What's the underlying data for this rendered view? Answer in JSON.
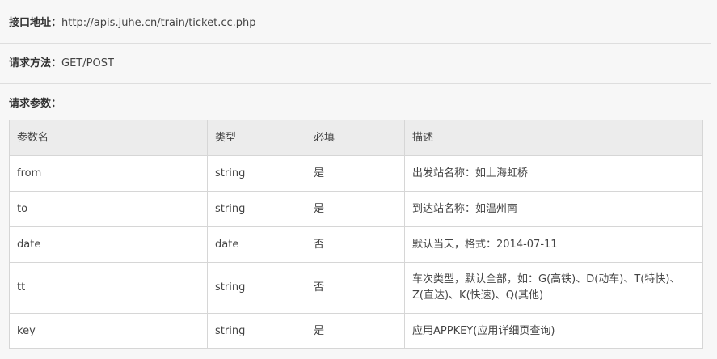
{
  "api": {
    "url_label": "接口地址：",
    "url_value": "http://apis.juhe.cn/train/ticket.cc.php",
    "method_label": "请求方法：",
    "method_value": "GET/POST",
    "params_label": "请求参数："
  },
  "table": {
    "headers": [
      "参数名",
      "类型",
      "必填",
      "描述"
    ],
    "rows": [
      {
        "name": "from",
        "type": "string",
        "required": "是",
        "desc": "出发站名称：如上海虹桥"
      },
      {
        "name": "to",
        "type": "string",
        "required": "是",
        "desc": "到达站名称：如温州南"
      },
      {
        "name": "date",
        "type": "date",
        "required": "否",
        "desc": "默认当天，格式：2014-07-11"
      },
      {
        "name": "tt",
        "type": "string",
        "required": "否",
        "desc": "车次类型，默认全部，如：G(高铁)、D(动车)、T(特快)、Z(直达)、K(快速)、Q(其他)"
      },
      {
        "name": "key",
        "type": "string",
        "required": "是",
        "desc": "应用APPKEY(应用详细页查询)"
      }
    ]
  }
}
